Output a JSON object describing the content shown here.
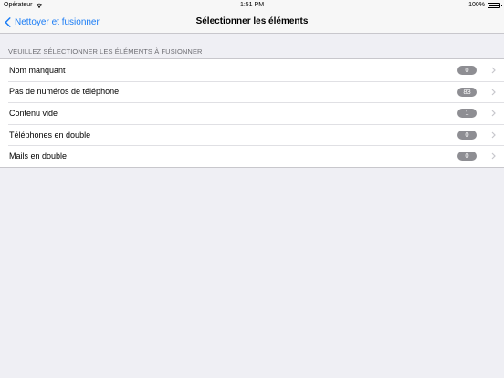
{
  "status_bar": {
    "carrier": "Opérateur",
    "time": "1:51 PM",
    "battery": "100%"
  },
  "nav": {
    "back_label": "Nettoyer et fusionner",
    "title": "Sélectionner les éléments"
  },
  "section": {
    "header": "VEUILLEZ SÉLECTIONNER LES ÉLÉMENTS À FUSIONNER"
  },
  "items": [
    {
      "label": "Nom manquant",
      "count": "0"
    },
    {
      "label": "Pas de numéros de téléphone",
      "count": "83"
    },
    {
      "label": "Contenu vide",
      "count": "1"
    },
    {
      "label": "Téléphones en double",
      "count": "0"
    },
    {
      "label": "Mails en double",
      "count": "0"
    }
  ],
  "colors": {
    "accent": "#1a7cf5",
    "badge": "#8e8e93",
    "background": "#efeff4"
  }
}
